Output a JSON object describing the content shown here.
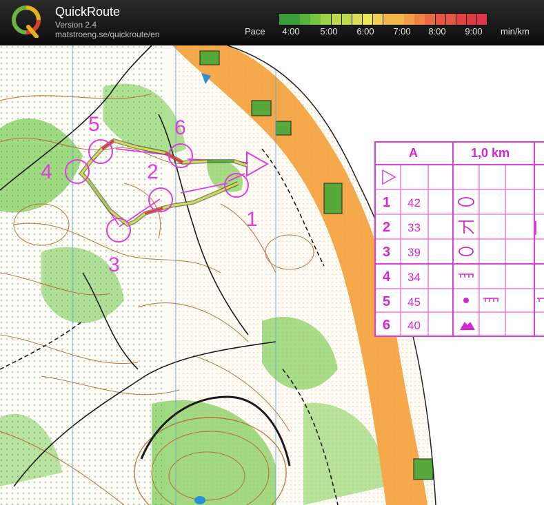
{
  "header": {
    "title": "QuickRoute",
    "version": "Version 2.4",
    "url": "matstroeng.se/quickroute/en",
    "logo_letter": "Q",
    "pace_label": "Pace",
    "pace_ticks": [
      "4:00",
      "5:00",
      "6:00",
      "7:00",
      "8:00",
      "9:00"
    ],
    "pace_unit": "min/km"
  },
  "map": {
    "controls": [
      {
        "label": "1"
      },
      {
        "label": "2"
      },
      {
        "label": "3"
      },
      {
        "label": "4"
      },
      {
        "label": "5"
      },
      {
        "label": "6"
      }
    ]
  },
  "legend": {
    "course": "A",
    "length": "1,0 km",
    "rows": [
      {
        "num": "1",
        "code": "42",
        "symbol": "knoll-ring"
      },
      {
        "num": "2",
        "code": "33",
        "symbol": "re-entrant"
      },
      {
        "num": "3",
        "code": "39",
        "symbol": "knoll-ring"
      },
      {
        "num": "4",
        "code": "34",
        "symbol": "earth-bank"
      },
      {
        "num": "5",
        "code": "45",
        "symbol": "dot-and-bank"
      },
      {
        "num": "6",
        "code": "40",
        "symbol": "rocky-hill"
      }
    ]
  },
  "colors": {
    "course": "#e13ce0",
    "route_fast": "#53b73a",
    "route_slow": "#e8372c",
    "forest": "#ffffff",
    "open": "#f5a94a",
    "green": "#8bd46f",
    "contour": "#b5652a"
  }
}
